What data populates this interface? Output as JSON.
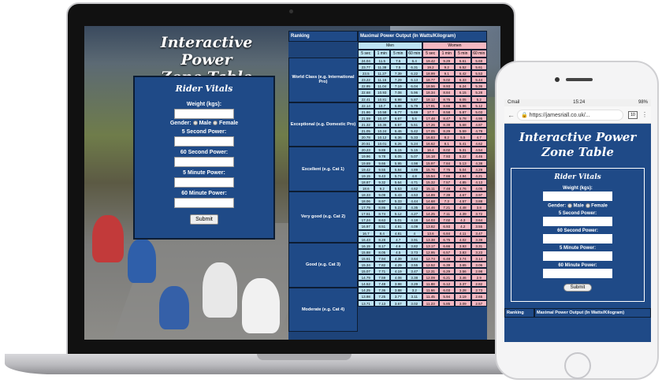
{
  "app": {
    "title": "Interactive Power Zone Table",
    "title_line1": "Interactive Power",
    "title_line2": "Zone Table"
  },
  "form": {
    "heading": "Rider Vitals",
    "weight_label": "Weight (kgs):",
    "gender_label": "Gender:",
    "gender_male": "Male",
    "gender_female": "Female",
    "sec5_label": "5 Second Power:",
    "sec60_label": "60 Second Power:",
    "min5_label": "5 Minute Power:",
    "min60_label": "60 Minute Power:",
    "submit_label": "Submit"
  },
  "table": {
    "ranking_header": "Ranking",
    "mpo_header": "Maximal Power Output (In Watts/Kilogram)",
    "men": "Men",
    "women": "Women",
    "durations": [
      "5 sec",
      "1 min",
      "5 min",
      "60 min",
      "5 sec",
      "1 min",
      "5 min",
      "60 min"
    ],
    "categories": [
      "World Class (e.g. International Pro)",
      "Exceptional (e.g. Domestic Pro)",
      "Excellent (e.g. Cat 1)",
      "Very good (e.g. Cat 2)",
      "Good (e.g. Cat 3)",
      "Moderate (e.g. Cat 4)"
    ],
    "rows": [
      [
        "24.04",
        "11.5",
        "7.6",
        "6.4",
        "19.42",
        "9.29",
        "6.61",
        "5.69"
      ],
      [
        "23.77",
        "11.38",
        "7.5",
        "6.31",
        "19.2",
        "9.2",
        "6.52",
        "5.61"
      ],
      [
        "23.5",
        "11.27",
        "7.39",
        "6.22",
        "18.99",
        "9.1",
        "6.42",
        "5.53"
      ],
      [
        "23.22",
        "11.16",
        "7.29",
        "6.13",
        "18.77",
        "9.02",
        "6.33",
        "5.44"
      ],
      [
        "22.95",
        "11.04",
        "7.19",
        "6.04",
        "18.56",
        "8.93",
        "6.24",
        "5.36"
      ],
      [
        "22.68",
        "10.93",
        "7.08",
        "5.96",
        "18.34",
        "8.84",
        "6.15",
        "5.28"
      ],
      [
        "22.41",
        "10.81",
        "6.98",
        "5.87",
        "18.12",
        "8.75",
        "6.05",
        "5.2"
      ],
      [
        "22.14",
        "10.7",
        "6.88",
        "5.79",
        "17.91",
        "8.66",
        "5.96",
        "5.12"
      ],
      [
        "21.86",
        "10.58",
        "6.77",
        "5.69",
        "17.7",
        "8.58",
        "5.87",
        "5.03"
      ],
      [
        "21.59",
        "10.47",
        "6.67",
        "5.6",
        "17.48",
        "8.47",
        "5.78",
        "4.95"
      ],
      [
        "21.32",
        "10.36",
        "6.57",
        "5.51",
        "17.26",
        "8.38",
        "5.68",
        "4.87"
      ],
      [
        "21.05",
        "10.24",
        "6.46",
        "5.42",
        "17.05",
        "8.29",
        "5.59",
        "4.79"
      ],
      [
        "20.78",
        "10.12",
        "6.36",
        "5.33",
        "16.83",
        "8.2",
        "5.5",
        "4.7"
      ],
      [
        "20.51",
        "10.01",
        "6.26",
        "5.24",
        "16.62",
        "8.1",
        "5.41",
        "4.62"
      ],
      [
        "20.23",
        "9.89",
        "6.15",
        "5.15",
        "16.4",
        "8.02",
        "5.31",
        "4.54"
      ],
      [
        "19.96",
        "9.78",
        "6.05",
        "5.07",
        "16.18",
        "7.93",
        "5.22",
        "4.46"
      ],
      [
        "19.69",
        "9.66",
        "5.95",
        "4.98",
        "15.97",
        "7.84",
        "5.13",
        "4.38"
      ],
      [
        "19.42",
        "9.55",
        "5.84",
        "4.89",
        "15.76",
        "7.75",
        "5.04",
        "4.29"
      ],
      [
        "19.15",
        "9.43",
        "5.74",
        "4.8",
        "15.54",
        "7.66",
        "4.94",
        "4.21"
      ],
      [
        "18.87",
        "9.32",
        "5.64",
        "4.71",
        "15.32",
        "7.57",
        "4.85",
        "4.13"
      ],
      [
        "18.6",
        "9.2",
        "5.53",
        "4.62",
        "15.11",
        "7.48",
        "4.76",
        "4.05"
      ],
      [
        "18.33",
        "9.09",
        "5.43",
        "4.53",
        "14.89",
        "7.39",
        "4.67",
        "3.97"
      ],
      [
        "18.06",
        "8.97",
        "5.33",
        "4.44",
        "14.68",
        "7.3",
        "4.57",
        "3.88"
      ],
      [
        "17.79",
        "8.86",
        "5.22",
        "4.35",
        "14.46",
        "7.21",
        "4.48",
        "3.8"
      ],
      [
        "17.51",
        "8.74",
        "5.12",
        "4.27",
        "14.25",
        "7.11",
        "4.39",
        "3.72"
      ],
      [
        "17.24",
        "8.63",
        "5.01",
        "4.18",
        "14.03",
        "7.02",
        "4.3",
        "3.64"
      ],
      [
        "16.97",
        "8.51",
        "4.91",
        "4.09",
        "13.82",
        "6.93",
        "4.2",
        "3.55"
      ],
      [
        "16.7",
        "8.4",
        "4.81",
        "4",
        "13.6",
        "6.84",
        "4.11",
        "3.47"
      ],
      [
        "16.43",
        "8.28",
        "4.7",
        "3.91",
        "13.38",
        "6.75",
        "4.02",
        "3.39"
      ],
      [
        "16.15",
        "8.17",
        "4.6",
        "3.82",
        "13.17",
        "6.66",
        "3.93",
        "3.31"
      ],
      [
        "15.88",
        "8.05",
        "4.5",
        "3.73",
        "12.95",
        "6.57",
        "3.83",
        "3.23"
      ],
      [
        "15.61",
        "7.94",
        "4.39",
        "3.64",
        "12.74",
        "6.48",
        "3.74",
        "3.14"
      ],
      [
        "15.34",
        "7.82",
        "4.29",
        "3.55",
        "12.52",
        "6.39",
        "3.65",
        "3.06"
      ],
      [
        "15.07",
        "7.71",
        "4.19",
        "3.47",
        "12.31",
        "6.29",
        "3.56",
        "2.98"
      ],
      [
        "14.79",
        "7.59",
        "4.08",
        "3.38",
        "12.09",
        "6.21",
        "3.46",
        "2.9"
      ],
      [
        "14.52",
        "7.48",
        "3.98",
        "3.29",
        "11.88",
        "6.12",
        "3.37",
        "2.82"
      ],
      [
        "14.25",
        "7.36",
        "3.88",
        "3.2",
        "11.66",
        "6.03",
        "3.28",
        "2.73"
      ],
      [
        "13.98",
        "7.25",
        "3.77",
        "3.11",
        "11.45",
        "5.94",
        "3.19",
        "2.65"
      ],
      [
        "13.71",
        "7.13",
        "3.67",
        "3.02",
        "11.23",
        "5.85",
        "3.09",
        "2.57"
      ]
    ]
  },
  "phone": {
    "status_left": "Cmail",
    "status_time": "15:24",
    "status_right": "98%",
    "url": "https://jamesriall.co.uk/...",
    "tabs_count": "10"
  },
  "colors": {
    "navy": "#1f4a87",
    "men_cell": "#bde3f3",
    "women_cell": "#f4b8c2"
  }
}
